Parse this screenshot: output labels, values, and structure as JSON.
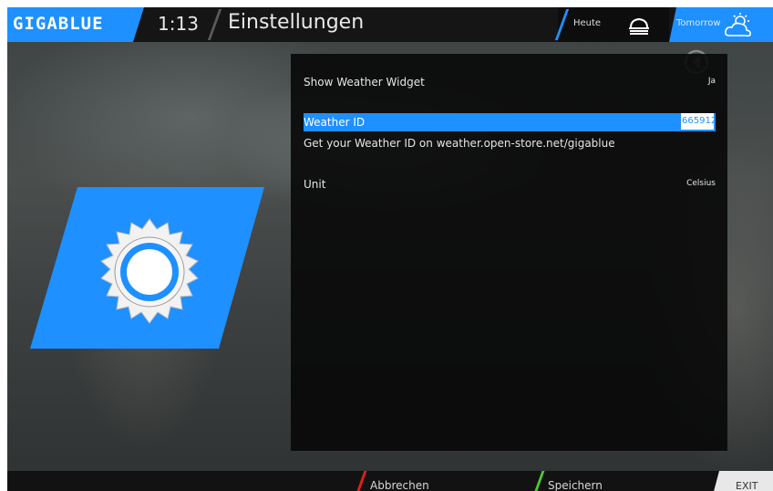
{
  "header": {
    "logo": "GIGABLUE",
    "clock": "1:13",
    "title": "Einstellungen",
    "weather_today_label": "Heute",
    "weather_tomorrow_label": "Tomorrow"
  },
  "settings": {
    "rows": [
      {
        "label": "Show Weather Widget",
        "value": "Ja"
      },
      {
        "label": "Weather ID",
        "value": "665912"
      },
      {
        "label": "Unit",
        "value": "Celsius"
      }
    ],
    "hint": "Get your Weather ID on weather.open-store.net/gigablue"
  },
  "footer": {
    "red_button": "Abbrechen",
    "green_button": "Speichern",
    "exit_button": "EXIT"
  },
  "colors": {
    "accent": "#1e90ff",
    "red": "#e02020",
    "green": "#4cc82c"
  },
  "icons": [
    "cloud-icon",
    "cloud-sun-icon",
    "sun-icon",
    "record-icon"
  ]
}
